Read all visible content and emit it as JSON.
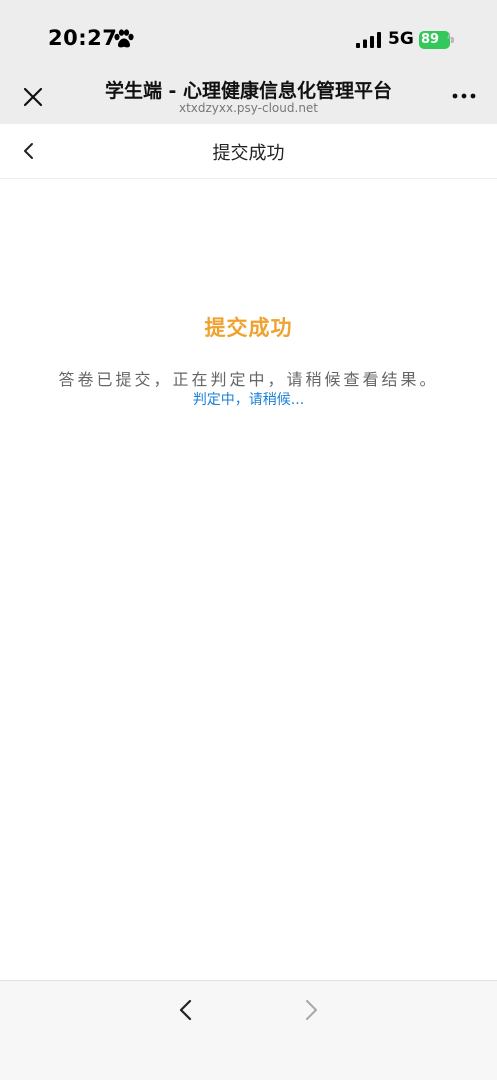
{
  "status_bar": {
    "time": "20:27",
    "network": "5G",
    "battery_level": "89",
    "icons": [
      "paw-icon",
      "signal-icon",
      "battery-icon"
    ]
  },
  "browser": {
    "title": "学生端 - 心理健康信息化管理平台",
    "url": "xtxdzyxx.psy-cloud.net",
    "close_icon": "close-icon",
    "more_icon": "more-icon"
  },
  "page": {
    "title": "提交成功",
    "back_icon": "chevron-left-icon"
  },
  "content": {
    "result_title": "提交成功",
    "message": "答卷已提交，正在判定中，请稍候查看结果。",
    "status": "判定中，请稍候..."
  },
  "toolbar": {
    "back_icon": "chevron-left-icon",
    "forward_icon": "chevron-right-icon"
  },
  "colors": {
    "accent_orange": "#f0a22e",
    "link_blue": "#1a7fd6",
    "battery_green": "#34c759"
  }
}
